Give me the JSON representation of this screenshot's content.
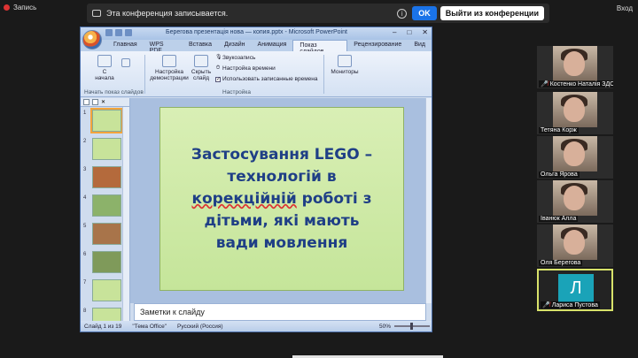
{
  "conference": {
    "recording_label": "Запись",
    "exit_label": "Вход",
    "notice_text": "Эта конференция записывается.",
    "ok_label": "OK",
    "leave_label": "Выйти из конференции",
    "info_symbol": "i"
  },
  "powerpoint": {
    "title": "Берегова презентація нова — копия.pptx - Microsoft PowerPoint",
    "window_controls": [
      "–",
      "□",
      "✕"
    ],
    "tabs": [
      {
        "label": "Главная"
      },
      {
        "label": "WPS PDF"
      },
      {
        "label": "Вставка"
      },
      {
        "label": "Дизайн"
      },
      {
        "label": "Анимация"
      },
      {
        "label": "Показ слайдов",
        "active": true
      },
      {
        "label": "Рецензирование"
      },
      {
        "label": "Вид"
      }
    ],
    "ribbon": {
      "from_start_line1": "С",
      "from_start_line2": "начала",
      "group1_label": "Начать показ слайдов",
      "setup_line1": "Настройка",
      "setup_line2": "демонстрации",
      "hide_line1": "Скрыть",
      "hide_line2": "слайд",
      "record_narration": "Звукозапись",
      "rehearse_timings": "Настройка времени",
      "use_timings": "Использовать записанные времена",
      "group2_label": "Настройка",
      "monitors": "Мониторы"
    },
    "thumbnail_count_visible": 8,
    "thumbnails": [
      {
        "num": "1",
        "color": "#c8e39a"
      },
      {
        "num": "2",
        "color": "#c8e39a"
      },
      {
        "num": "3",
        "color": "#b46a3c"
      },
      {
        "num": "4",
        "color": "#8cb26a"
      },
      {
        "num": "5",
        "color": "#a8744a"
      },
      {
        "num": "6",
        "color": "#7f9a5a"
      },
      {
        "num": "7",
        "color": "#c8e39a"
      },
      {
        "num": "8",
        "color": "#c8e39a"
      }
    ],
    "slide": {
      "line1": "Застосування LEGO –",
      "line2": "технологій в",
      "line3_underlined": "корекційній",
      "line3_rest": " роботі з",
      "line4": "дітьми, які мають",
      "line5": "вади мовлення"
    },
    "notes_placeholder": "Заметки к слайду",
    "status": {
      "slide_info": "Слайд 1 из 19",
      "theme": "\"Тема Office\"",
      "language": "Русский (Россия)",
      "zoom": "50%"
    }
  },
  "participants": [
    {
      "name": "Костенко Наталія ЗДО",
      "muted": true
    },
    {
      "name": "Тетяна Корж",
      "muted": false
    },
    {
      "name": "Ольга Ярова",
      "muted": false
    },
    {
      "name": "Іванюк Алла",
      "muted": false
    },
    {
      "name": "Оля Берегова",
      "muted": false
    },
    {
      "name": "Лариса Пустова",
      "muted": true,
      "initial": "Л",
      "avatar_color": "#1aa3b8",
      "active": true
    }
  ]
}
